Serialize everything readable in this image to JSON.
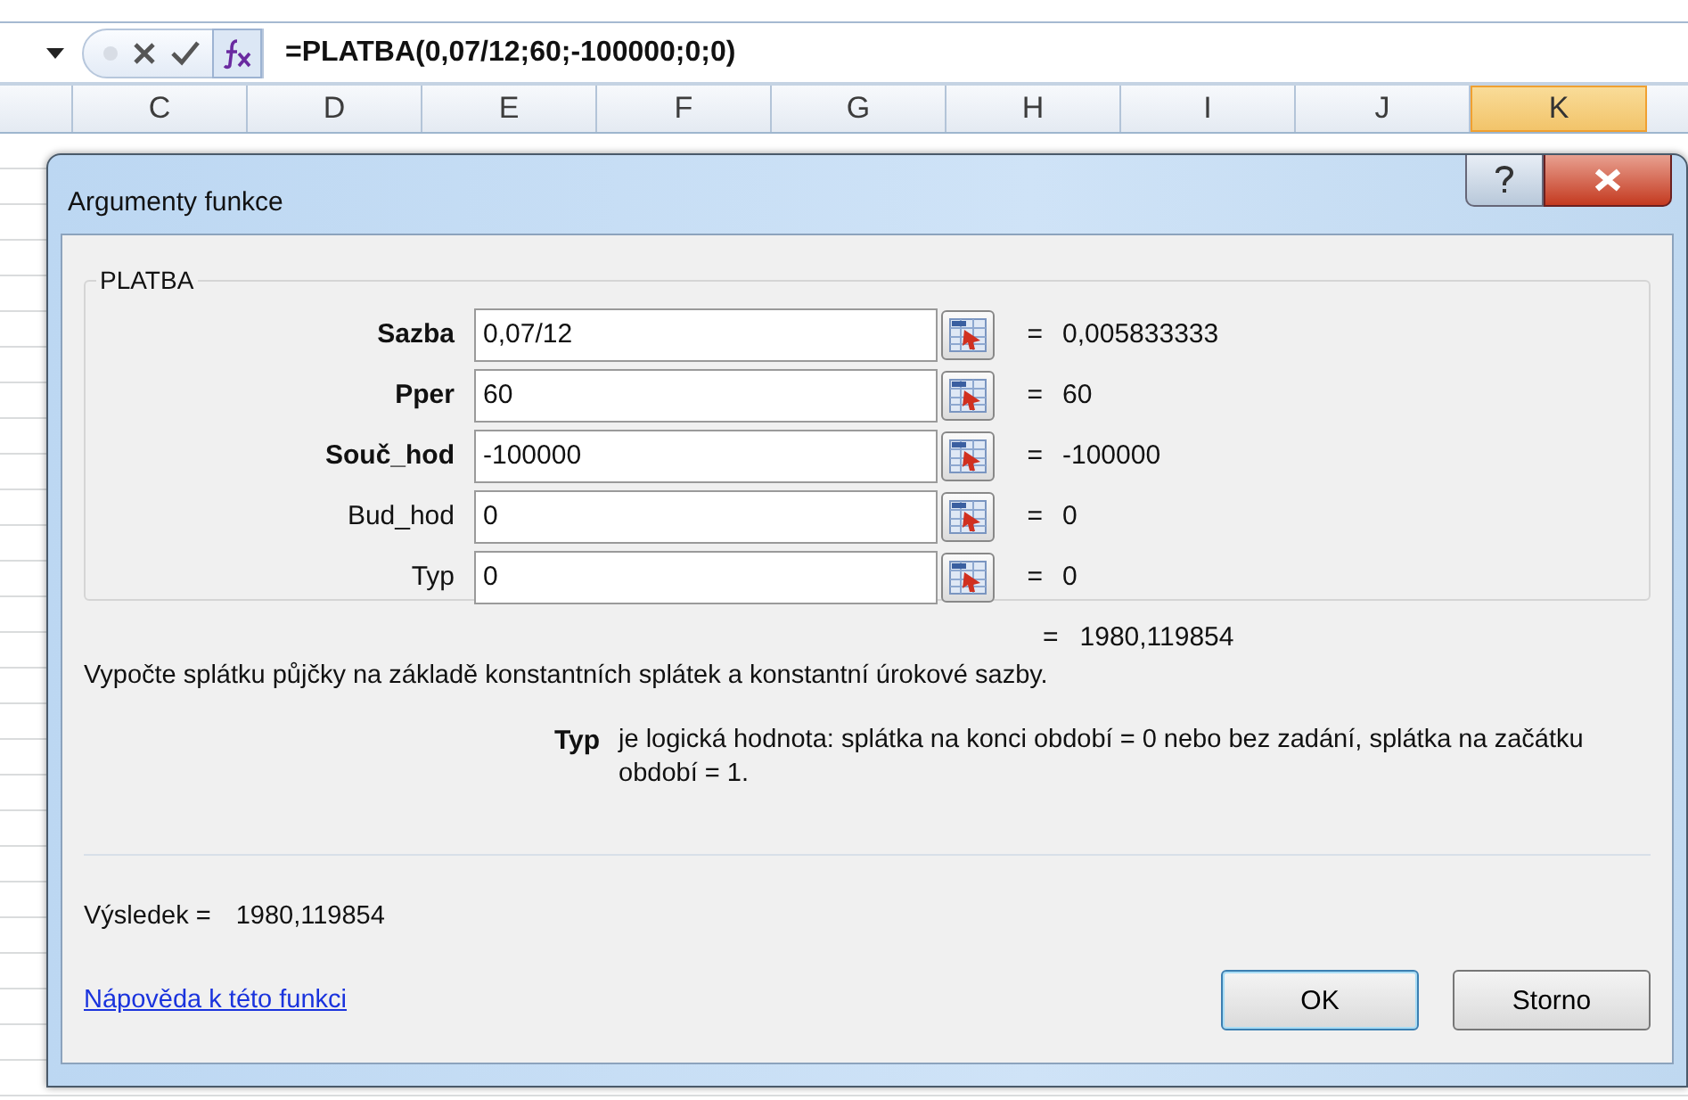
{
  "formula_bar": {
    "formula": "=PLATBA(0,07/12;60;-100000;0;0)"
  },
  "columns": [
    {
      "label": "C",
      "selected": false
    },
    {
      "label": "D",
      "selected": false
    },
    {
      "label": "E",
      "selected": false
    },
    {
      "label": "F",
      "selected": false
    },
    {
      "label": "G",
      "selected": false
    },
    {
      "label": "H",
      "selected": false
    },
    {
      "label": "I",
      "selected": false
    },
    {
      "label": "J",
      "selected": false
    },
    {
      "label": "K",
      "selected": true
    }
  ],
  "dialog": {
    "title": "Argumenty funkce",
    "group_title": "PLATBA",
    "arguments": [
      {
        "label": "Sazba",
        "required": true,
        "value": "0,07/12",
        "equals": "=",
        "result": "0,005833333"
      },
      {
        "label": "Pper",
        "required": true,
        "value": "60",
        "equals": "=",
        "result": "60"
      },
      {
        "label": "Souč_hod",
        "required": true,
        "value": "-100000",
        "equals": "=",
        "result": "-100000"
      },
      {
        "label": "Bud_hod",
        "required": false,
        "value": "0",
        "equals": "=",
        "result": "0"
      },
      {
        "label": "Typ",
        "required": false,
        "value": "0",
        "equals": "=",
        "result": "0"
      }
    ],
    "formula_equals": "=",
    "formula_result": "1980,119854",
    "description": "Vypočte splátku půjčky na základě konstantních splátek a konstantní úrokové sazby.",
    "argument_help": {
      "name": "Typ",
      "text": "je logická hodnota: splátka na konci období = 0 nebo bez zadání, splátka na začátku období = 1."
    },
    "result_label": "Výsledek =",
    "result_value": "1980,119854",
    "help_link": "Nápověda k této funkci",
    "buttons": [
      {
        "label": "OK",
        "default": true
      },
      {
        "label": "Storno",
        "default": false
      }
    ]
  }
}
